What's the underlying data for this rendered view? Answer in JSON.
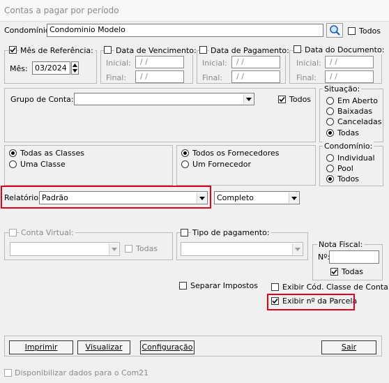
{
  "window": {
    "title": "Contas a pagar por período"
  },
  "condominio": {
    "label": "Condomínio:",
    "value": "Condominio Modelo",
    "todos_label": "Todos",
    "todos_checked": false
  },
  "mes_ref": {
    "label": "Mês de Referência:",
    "checked": true,
    "mes_label": "Mês:",
    "mes_value": "03/2024"
  },
  "vencimento": {
    "label": "Data de Vencimento:",
    "checked": false,
    "inicial_label": "Inicial:",
    "final_label": "Final:",
    "inicial_value": "/ /",
    "final_value": "/ /"
  },
  "pagamento": {
    "label": "Data de Pagamento:",
    "checked": false,
    "inicial_label": "Inicial:",
    "final_label": "Final:",
    "inicial_value": "/ /",
    "final_value": "/ /"
  },
  "documento": {
    "label": "Data do Documento:",
    "checked": false,
    "inicial_label": "Inicial:",
    "final_label": "Final:",
    "inicial_value": "/ /",
    "final_value": "/ /"
  },
  "grupo_conta": {
    "label": "Grupo de Conta:",
    "value": "",
    "todos_label": "Todos",
    "todos_checked": true
  },
  "situacao": {
    "label": "Situação:",
    "options": [
      "Em Aberto",
      "Baixadas",
      "Canceladas",
      "Todas"
    ],
    "selected": "Todas"
  },
  "classes": {
    "options": [
      "Todas as Classes",
      "Uma Classe"
    ],
    "selected": "Todas as Classes"
  },
  "fornecedores": {
    "options": [
      "Todos os Fornecedores",
      "Um Fornecedor"
    ],
    "selected": "Todos os Fornecedores"
  },
  "condominio_tipo": {
    "label": "Condomínio:",
    "options": [
      "Individual",
      "Pool",
      "Todos"
    ],
    "selected": "Todos"
  },
  "relatorio": {
    "label": "Relatório:",
    "value": "Padrão",
    "modo_value": "Completo"
  },
  "conta_virtual": {
    "label": "Conta Virtual:",
    "checked": false,
    "todas_label": "Todas"
  },
  "tipo_pagamento": {
    "label": "Tipo de pagamento:",
    "checked": false
  },
  "nota_fiscal": {
    "label": "Nota Fiscal:",
    "no_label": "Nº:",
    "value": "",
    "todas_label": "Todas",
    "todas_checked": true
  },
  "opcoes": {
    "separar_impostos": "Separar Impostos",
    "exibir_cod_classe": "Exibir Cód. Classe de Conta",
    "exibir_parcela": "Exibir nº da Parcela",
    "parcela_checked": true
  },
  "buttons": {
    "imprimir": "Imprimir",
    "visualizar": "Visualizar",
    "configuracao": "Configuração",
    "sair": "Sair"
  },
  "footer": {
    "com21_label": "Disponibilizar dados para o Com21"
  },
  "colors": {
    "highlight": "#e0001b",
    "disabled_text": "#8a8a8a"
  }
}
